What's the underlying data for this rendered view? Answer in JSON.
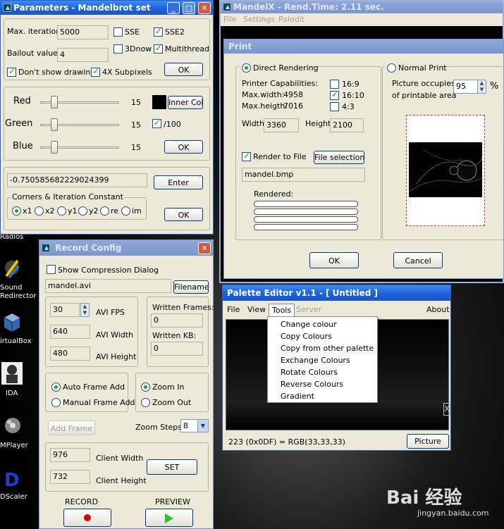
{
  "desktop": {
    "icons": [
      {
        "label": "Radios"
      },
      {
        "label": "Sound\nRedirector"
      },
      {
        "label": "irtualBox"
      },
      {
        "label": "IDA"
      },
      {
        "label": "MPlayer"
      },
      {
        "label": "DScaler"
      }
    ]
  },
  "watermark": {
    "brand": "Bai 经验",
    "url": "jingyan.baidu.com"
  },
  "params": {
    "title": "Parameters - Mandelbrot set",
    "max_iter_label": "Max. iteration",
    "max_iter": "5000",
    "bailout_label": "Bailout value",
    "bailout": "4",
    "sse": "SSE",
    "sse2": "SSE2",
    "now3d": "3Dnow",
    "multithread": "Multithread",
    "dont_show": "Don't show drawing",
    "subpix": "4X Subpixels",
    "ok": "OK",
    "red": "Red",
    "green": "Green",
    "blue": "Blue",
    "red_v": "15",
    "green_v": "15",
    "blue_v": "15",
    "slider_fraction": 0.15,
    "inner_col": "Inner Col",
    "div100": "/100",
    "const_value": "-0.750585682229024399",
    "enter": "Enter",
    "corners_label": "Corners & Iteration Constant",
    "radios": [
      "x1",
      "x2",
      "y1",
      "y2",
      "re",
      "im"
    ]
  },
  "main": {
    "title": "MandelX - Rend.Time:  2.11 sec.",
    "menus": [
      "File",
      "Settings",
      "Paledit"
    ]
  },
  "print": {
    "title": "Print",
    "direct": "Direct Rendering",
    "normal": "Normal Print",
    "caps": "Printer Capabilities:",
    "maxw_label": "Max.width:",
    "maxw": "4958",
    "maxh_label": "Max.heigth:",
    "maxh": "7016",
    "r169": "16:9",
    "r1610": "16:10",
    "r43": "4:3",
    "width_label": "Width:",
    "width": "3360",
    "height_label": "Height:",
    "height": "2100",
    "render_file": "Render to File",
    "file_sel": "File selection",
    "filename": "mandel.bmp",
    "rendered": "Rendered:",
    "picture_occ1": "Picture occupies",
    "picture_occ2": "of printable area",
    "percent": "95",
    "pct_sign": "%",
    "ok": "OK",
    "cancel": "Cancel"
  },
  "record": {
    "title": "Record Config",
    "show_comp": "Show Compression Dialog",
    "filename": "mandel.avi",
    "filename_btn": "Filename",
    "fps": "30",
    "fps_label": "AVI FPS",
    "w": "640",
    "w_label": "AVI Width",
    "h": "480",
    "h_label": "AVI Height",
    "written_frames": "Written Frames:",
    "wf": "0",
    "written_kb": "Written KB:",
    "wkb": "0",
    "auto_frame": "Auto Frame Add",
    "manual_frame": "Manual Frame Add",
    "zoom_in": "Zoom In",
    "zoom_out": "Zoom Out",
    "add_frame": "Add Frame",
    "zoom_steps": "Zoom Steps:",
    "zoom_steps_v": "8",
    "cw": "976",
    "cw_label": "Client Width",
    "ch": "732",
    "ch_label": "Client Height",
    "set": "SET",
    "record": "RECORD",
    "preview": "PREVIEW"
  },
  "palette": {
    "title": "Palette Editor v1.1 - [ Untitled ]",
    "menus": [
      "File",
      "View",
      "Tools",
      "Server"
    ],
    "about": "About",
    "tools_items": [
      "Change colour",
      "Copy Colours",
      "Copy from other palette",
      "Exchange Colours",
      "Rotate Colours",
      "Reverse Colours",
      "Gradient"
    ],
    "status": "223 (0x0DF) = RGB(33,33,33)",
    "picture": "Picture",
    "marker": "X"
  },
  "colors": {
    "title_active": "#1b5fd6",
    "face": "#ece9d8",
    "rec_red": "#e00000",
    "play_green": "#2fbf2f"
  }
}
